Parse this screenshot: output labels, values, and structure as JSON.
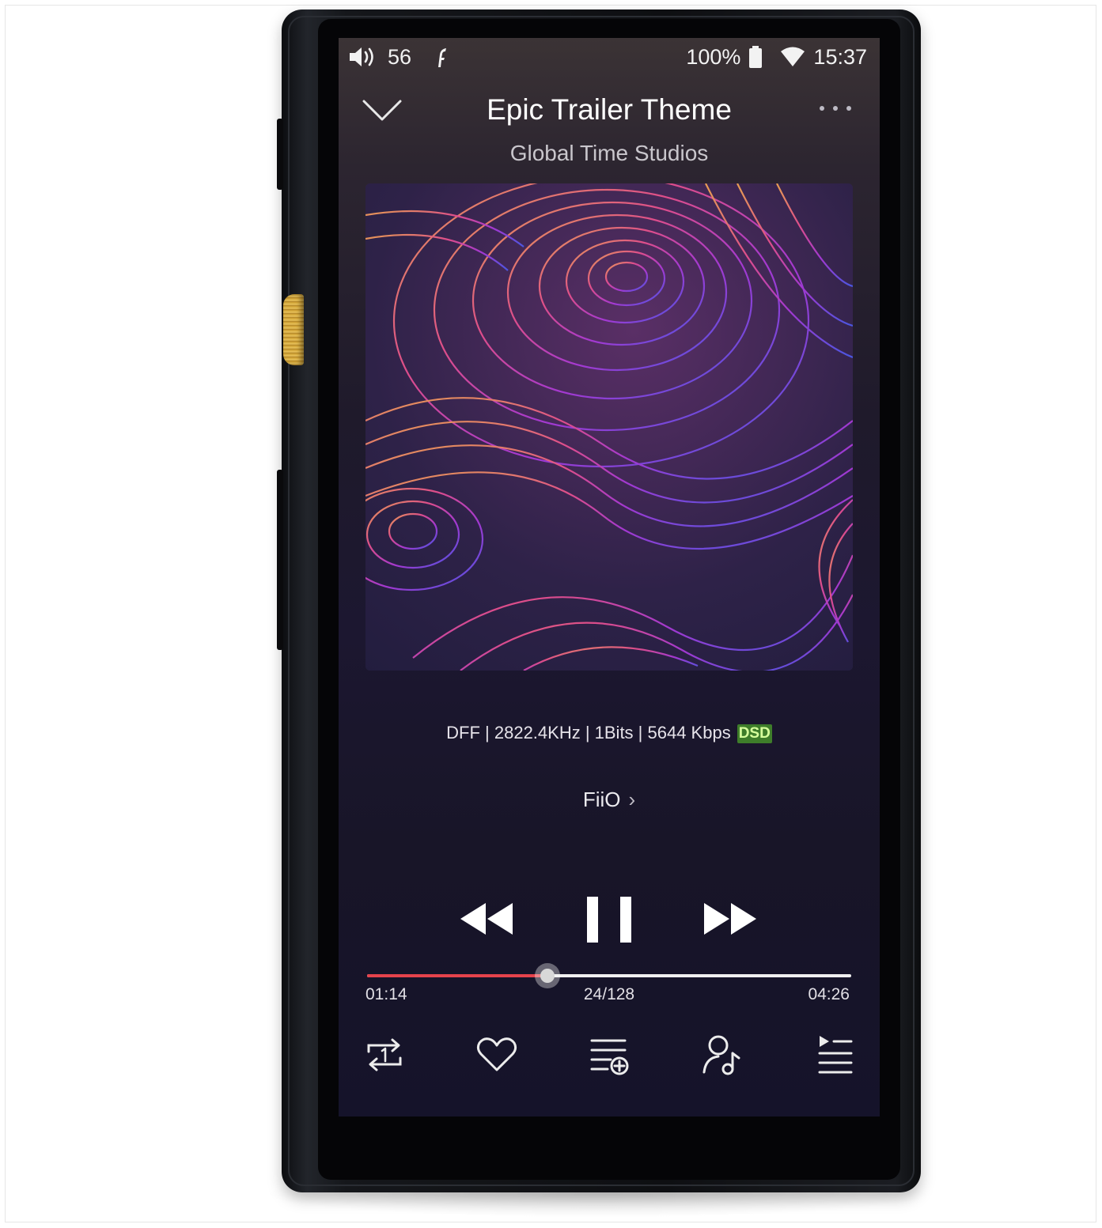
{
  "status_bar": {
    "volume": "56",
    "battery": "100%",
    "clock": "15:37"
  },
  "now_playing": {
    "title": "Epic Trailer Theme",
    "artist": "Global Time Studios",
    "format_info": "DFF | 2822.4KHz | 1Bits | 5644 Kbps",
    "format_badge": "DSD",
    "source": "FiiO",
    "elapsed": "01:14",
    "duration": "04:26",
    "track_position": "24/128",
    "progress_fraction": 0.373
  },
  "colors": {
    "progress_played": "#e5434c",
    "progress_remaining": "#f0f0f0",
    "badge_background": "#3e7d2a",
    "badge_text": "#d6ff9c"
  },
  "icons": {
    "status": [
      "speaker-icon",
      "fiio-logo-icon",
      "battery-icon",
      "wifi-icon"
    ],
    "header": [
      "chevron-down-icon",
      "more-icon"
    ],
    "transport": [
      "previous-icon",
      "pause-icon",
      "next-icon"
    ],
    "bottom": [
      "repeat-one-icon",
      "heart-icon",
      "add-to-playlist-icon",
      "artist-icon",
      "queue-icon"
    ]
  }
}
